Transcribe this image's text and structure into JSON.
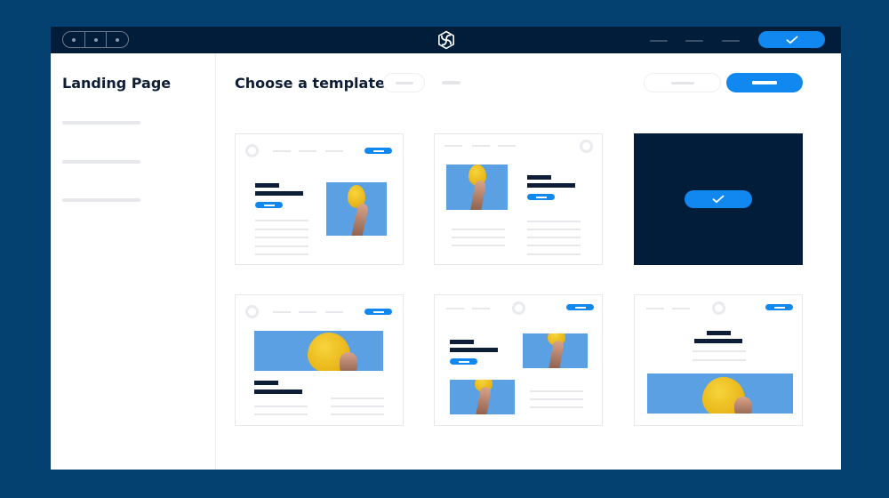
{
  "window": {
    "titlebar": {
      "controls": [
        "control-1",
        "control-2",
        "control-3"
      ],
      "logo_icon": "swirl-logo-icon",
      "menu_items": [
        "menu-item-1",
        "menu-item-2",
        "menu-item-3"
      ],
      "confirm_icon": "checkmark-icon"
    }
  },
  "sidebar": {
    "title": "Landing Page",
    "items": [
      "placeholder-item-1",
      "placeholder-item-2",
      "placeholder-item-3"
    ]
  },
  "main": {
    "title": "Choose a template",
    "tabs": [
      "tab-pill",
      "tab-plain"
    ],
    "actions": [
      "secondary-button",
      "primary-button"
    ]
  },
  "templates": [
    {
      "id": 1,
      "layout": "text-left-image-right",
      "selected": false
    },
    {
      "id": 2,
      "layout": "image-left-text-right",
      "selected": false
    },
    {
      "id": 3,
      "layout": "selected",
      "selected": true,
      "icon": "checkmark-icon"
    },
    {
      "id": 4,
      "layout": "banner-image-top",
      "selected": false
    },
    {
      "id": 5,
      "layout": "zigzag-images",
      "selected": false
    },
    {
      "id": 6,
      "layout": "centered-text-banner-bottom",
      "selected": false
    }
  ],
  "colors": {
    "background": "#044170",
    "titlebar": "#021d3a",
    "accent": "#1187f0",
    "heading": "#0d1e36",
    "placeholder": "#e6e8eb",
    "image_sky": "#5aa0e2",
    "lemon": "#f0c52a"
  }
}
